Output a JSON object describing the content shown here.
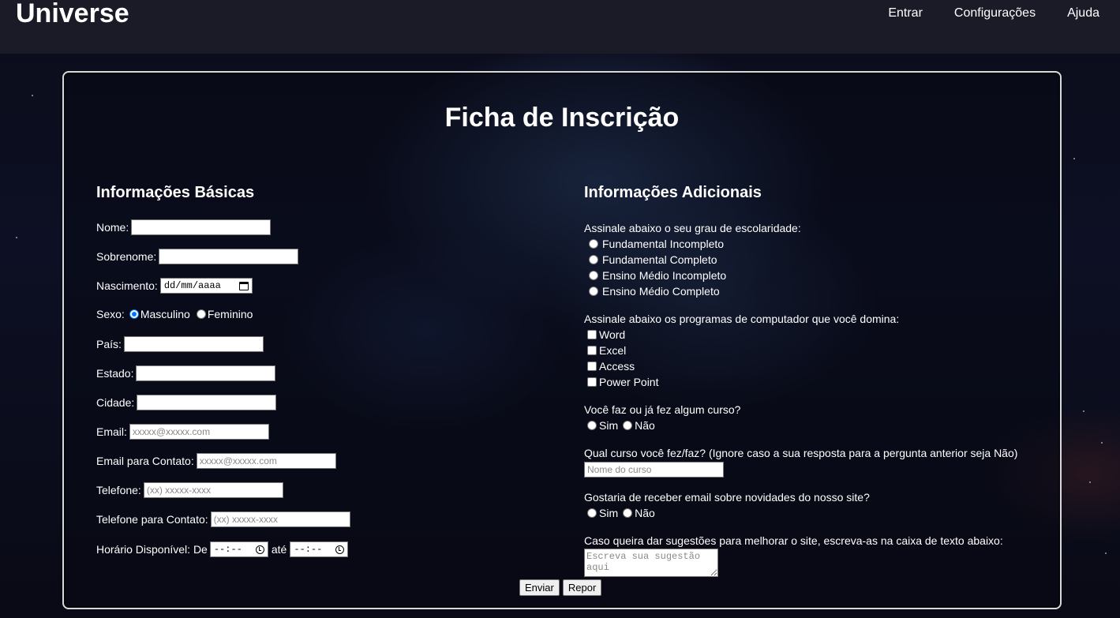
{
  "header": {
    "brand": "Universe",
    "nav": [
      "Entrar",
      "Configurações",
      "Ajuda"
    ]
  },
  "form": {
    "title": "Ficha de Inscrição",
    "basic": {
      "title": "Informações Básicas",
      "nome_label": "Nome:",
      "sobrenome_label": "Sobrenome:",
      "nascimento_label": "Nascimento:",
      "nascimento_placeholder": "dd/mm/aaaa",
      "sexo_label": "Sexo:",
      "sexo_options": [
        "Masculino",
        "Feminino"
      ],
      "pais_label": "País:",
      "estado_label": "Estado:",
      "cidade_label": "Cidade:",
      "email_label": "Email:",
      "email_placeholder": "xxxxx@xxxxx.com",
      "email_contato_label": "Email para Contato:",
      "email_contato_placeholder": "xxxxx@xxxxx.com",
      "telefone_label": "Telefone:",
      "telefone_placeholder": "(xx) xxxxx-xxxx",
      "telefone_contato_label": "Telefone para Contato:",
      "telefone_contato_placeholder": "(xx) xxxxx-xxxx",
      "horario_label": "Horário Disponível: De",
      "horario_ate": "até",
      "time_placeholder": "--:--"
    },
    "extra": {
      "title": "Informações Adicionais",
      "escolaridade_question": "Assinale abaixo o seu grau de escolaridade:",
      "escolaridade_options": [
        "Fundamental Incompleto",
        "Fundamental Completo",
        "Ensino Médio Incompleto",
        "Ensino Médio Completo"
      ],
      "programas_question": "Assinale abaixo os programas de computador que você domina:",
      "programas_options": [
        "Word",
        "Excel",
        "Access",
        "Power Point"
      ],
      "curso_question": "Você faz ou já fez algum curso?",
      "curso_options": [
        "Sim",
        "Não"
      ],
      "qual_curso_question": "Qual curso você fez/faz? (Ignore caso a sua resposta para a pergunta anterior seja Não)",
      "qual_curso_placeholder": "Nome do curso",
      "email_news_question": "Gostaria de receber email sobre novidades do nosso site?",
      "email_news_options": [
        "Sim",
        "Não"
      ],
      "sugestao_question": "Caso queira dar sugestões para melhorar o site, escreva-as na caixa de texto abaixo:",
      "sugestao_placeholder": "Escreva sua sugestão aqui"
    },
    "buttons": {
      "submit": "Enviar",
      "reset": "Repor"
    }
  }
}
